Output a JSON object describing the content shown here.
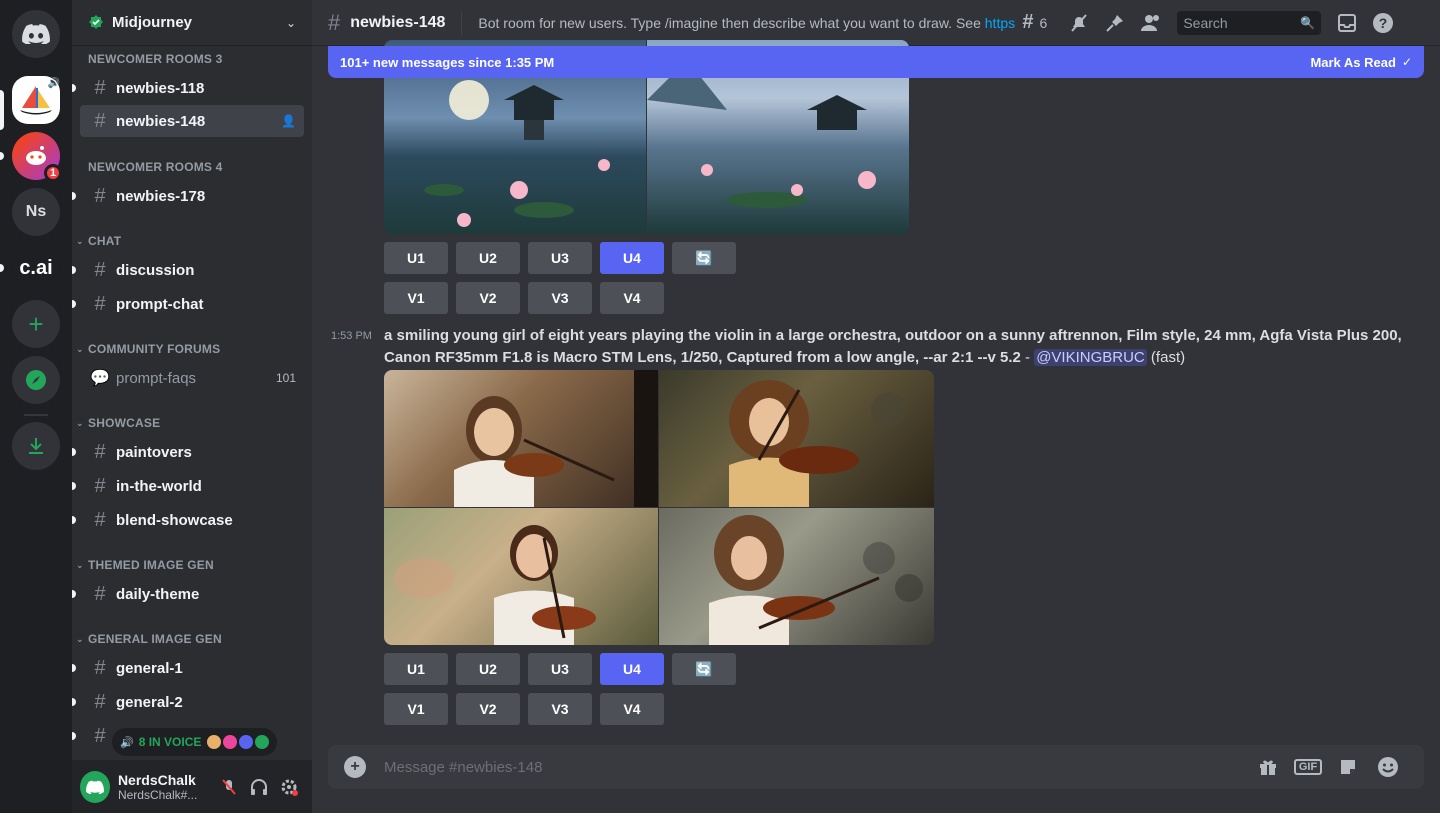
{
  "servers": [
    {
      "name": "discord-home",
      "initials": ""
    },
    {
      "name": "midjourney",
      "initials": ""
    },
    {
      "name": "reddit",
      "initials": "",
      "badge": "1"
    },
    {
      "name": "ns",
      "initials": "Ns"
    },
    {
      "name": "character-ai",
      "initials": "c.ai"
    }
  ],
  "guild": {
    "name": "Midjourney"
  },
  "categories": {
    "c1": "NEWCOMER ROOMS 3",
    "c2": "NEWCOMER ROOMS 4",
    "c3": "CHAT",
    "c4": "COMMUNITY FORUMS",
    "c5": "SHOWCASE",
    "c6": "THEMED IMAGE GEN",
    "c7": "GENERAL IMAGE GEN"
  },
  "channels": {
    "newbies118": "newbies-118",
    "newbies148": "newbies-148",
    "newbies178": "newbies-178",
    "discussion": "discussion",
    "promptchat": "prompt-chat",
    "promptfaqs": "prompt-faqs",
    "promptfaqs_count": "101",
    "paintovers": "paintovers",
    "intheworld": "in-the-world",
    "blendshowcase": "blend-showcase",
    "dailytheme": "daily-theme",
    "general1": "general-1",
    "general2": "general-2"
  },
  "voice": {
    "label": "8 IN VOICE"
  },
  "user": {
    "name": "NerdsChalk",
    "tag": "NerdsChalk#..."
  },
  "topbar": {
    "channel": "newbies-148",
    "topic": "Bot room for new users. Type /imagine then describe what you want to draw. See ",
    "topic_link": "https:/...",
    "threads_count": "6",
    "search_placeholder": "Search"
  },
  "newbar": {
    "text": "101+ new messages since 1:35 PM",
    "action": "Mark As Read"
  },
  "buttons": {
    "u1": "U1",
    "u2": "U2",
    "u3": "U3",
    "u4": "U4",
    "v1": "V1",
    "v2": "V2",
    "v3": "V3",
    "v4": "V4",
    "reroll": "🔄"
  },
  "message": {
    "time": "1:53 PM",
    "prompt": "a smiling young girl of eight years playing the violin in a large orchestra, outdoor on a sunny aftrennon, Film style, 24 mm, Agfa Vista Plus 200, Canon RF35mm F1.8 is Macro STM Lens, 1/250, Captured from a low angle, --ar 2:1 --v 5.2",
    "separator": " - ",
    "mention": "@VIKINGBRUC",
    "suffix": " (fast)"
  },
  "composer": {
    "placeholder": "Message #newbies-148"
  },
  "colors": {
    "blurple": "#5865f2",
    "green": "#23a55a",
    "red": "#f23f43",
    "link": "#00a8fc"
  }
}
